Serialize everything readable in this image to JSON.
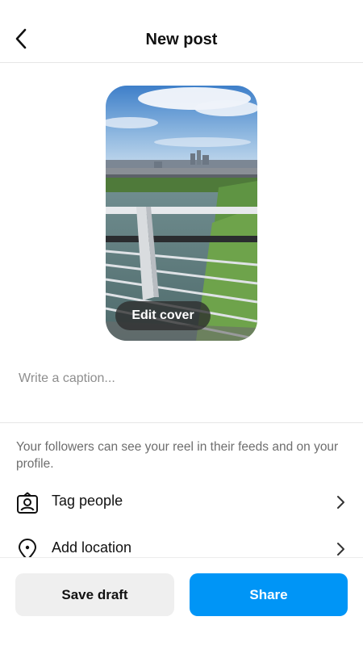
{
  "header": {
    "title": "New post",
    "back_icon": "chevron-left-icon"
  },
  "cover": {
    "edit_label": "Edit cover"
  },
  "caption": {
    "placeholder": "Write a caption...",
    "value": ""
  },
  "info_text": "Your followers can see your reel in their feeds and on your profile.",
  "options": [
    {
      "label": "Tag people",
      "icon": "tag-person-icon"
    },
    {
      "label": "Add location",
      "icon": "location-pin-icon"
    }
  ],
  "actions": {
    "save_draft": "Save draft",
    "share": "Share"
  },
  "colors": {
    "accent": "#0095f6",
    "secondary_button": "#efefef",
    "muted_text": "#6e6e6e"
  }
}
